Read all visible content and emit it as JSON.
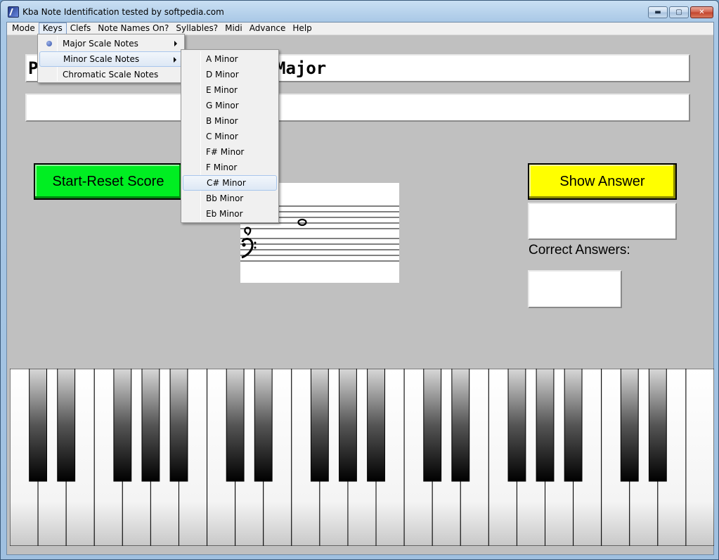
{
  "window": {
    "title": "Kba Note Identification tested by softpedia.com",
    "minimize_icon": "minimize-icon",
    "maximize_icon": "maximize-icon",
    "close_icon": "close-icon"
  },
  "menubar": {
    "items": [
      "Mode",
      "Keys",
      "Clefs",
      "Note Names On?",
      "Syllables?",
      "Midi",
      "Advance",
      "Help"
    ],
    "active": "Keys"
  },
  "keys_menu": {
    "items": [
      {
        "label": "Major Scale Notes",
        "checked": true,
        "submenu": true
      },
      {
        "label": "Minor Scale Notes",
        "checked": false,
        "submenu": true,
        "highlighted": true
      },
      {
        "label": "Chromatic Scale Notes",
        "checked": false,
        "submenu": false
      }
    ]
  },
  "minor_submenu": {
    "items": [
      "A Minor",
      "D Minor",
      "E Minor",
      "G Minor",
      "B Minor",
      "C Minor",
      "F# Minor",
      "F Minor",
      "C# Minor",
      "Bb Minor",
      "Eb Minor"
    ],
    "highlighted": "C# Minor"
  },
  "main": {
    "key_display_left": "P",
    "key_display_right": "Major",
    "second_display": "",
    "start_button": "Start-Reset Score",
    "show_answer_button": "Show Answer",
    "answer_value": "",
    "correct_answers_label": "Correct Answers:",
    "correct_answers_value": ""
  },
  "colors": {
    "start_button": "#00ee22",
    "show_answer_button": "#ffff00",
    "client_bg": "#c0c0c0"
  },
  "piano": {
    "white_keys": 25,
    "black_keys": 17
  }
}
